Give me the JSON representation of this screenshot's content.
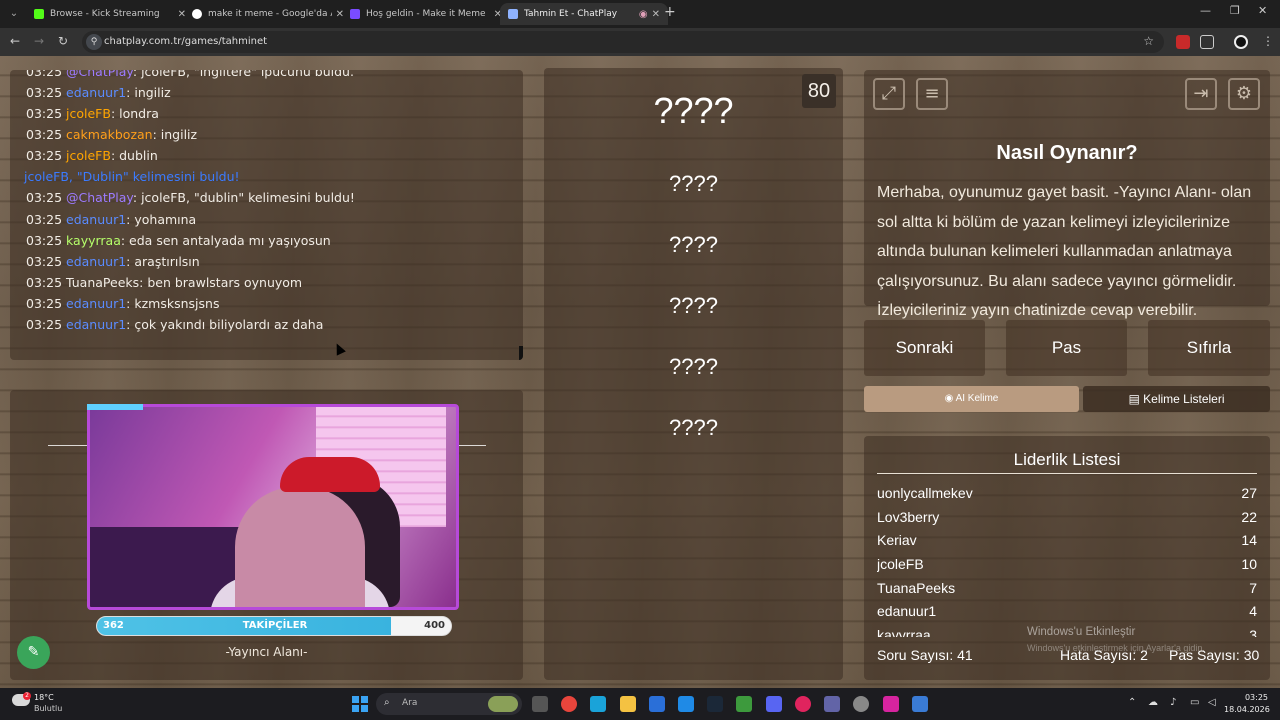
{
  "browser": {
    "tabs": [
      {
        "title": "Browse - Kick Streaming",
        "fav_color": "#53fc18"
      },
      {
        "title": "make it meme - Google'da Ara",
        "fav_color": "#ffffff"
      },
      {
        "title": "Hoş geldin - Make it Meme",
        "fav_color": "#7a4cff"
      },
      {
        "title": "Tahmin Et - ChatPlay",
        "fav_color": "#8fb3ff"
      }
    ],
    "url": "chatplay.com.tr/games/tahminet"
  },
  "chat": {
    "lines": [
      {
        "time": "03:25",
        "user": "@ChatPlay",
        "user_color": "#9d7bff",
        "msg": ": jcoleFB, \"ingiltere\" ipucunu buldu."
      },
      {
        "time": "03:25",
        "user": "edanuur1",
        "user_color": "#5b8cff",
        "msg": ": ingiliz"
      },
      {
        "time": "03:25",
        "user": "jcoleFB",
        "user_color": "#ffa500",
        "msg": ": londra"
      },
      {
        "time": "03:25",
        "user": "cakmakbozan",
        "user_color": "#ff9f1a",
        "msg": ": ingiliz"
      },
      {
        "time": "03:25",
        "user": "jcoleFB",
        "user_color": "#ffa500",
        "msg": ": dublin"
      },
      {
        "time": "",
        "user": "jcoleFB, \"Dublin\" kelimesini buldu!",
        "user_color": "#3b7bff",
        "msg": ""
      },
      {
        "time": "03:25",
        "user": "@ChatPlay",
        "user_color": "#9d7bff",
        "msg": ": jcoleFB, \"dublin\" kelimesini buldu!"
      },
      {
        "time": "03:25",
        "user": "edanuur1",
        "user_color": "#5b8cff",
        "msg": ": yohamına"
      },
      {
        "time": "03:25",
        "user": "kayyrraa",
        "user_color": "#b6ff6b",
        "msg": ": eda sen antalyada mı yaşıyosun"
      },
      {
        "time": "03:25",
        "user": "edanuur1",
        "user_color": "#5b8cff",
        "msg": ": araştırılsın"
      },
      {
        "time": "03:25",
        "user": "TuanaPeeks",
        "user_color": "#f2ede6",
        "msg": ": ben brawlstars oynuyom"
      },
      {
        "time": "03:25",
        "user": "edanuur1",
        "user_color": "#5b8cff",
        "msg": ": kzmsksnsjsns"
      },
      {
        "time": "03:25",
        "user": "edanuur1",
        "user_color": "#5b8cff",
        "msg": ": çok yakındı biliyolardı az daha"
      }
    ]
  },
  "streamer": {
    "followers_min": "362",
    "followers_max": "400",
    "followers_label": "TAKİPÇİLER",
    "followers_progress": 0.83,
    "area_label": "-Yayıncı Alanı-"
  },
  "game": {
    "timer": "80",
    "main_word": "????",
    "words": [
      "????",
      "????",
      "????",
      "????",
      "????"
    ]
  },
  "help": {
    "title": "Nasıl Oynanır?",
    "text": "Merhaba, oyunumuz gayet basit. -Yayıncı Alanı- olan sol altta ki bölüm de yazan kelimeyi izleyicilerinize altında bulunan kelimeleri kullanmadan anlatmaya çalışıyorsunuz. Bu alanı sadece yayıncı görmelidir. İzleyicileriniz yayın chatinizde cevap verebilir."
  },
  "controls": {
    "next": "Sonraki",
    "pass": "Pas",
    "reset": "Sıfırla",
    "ai_word": "AI Kelime",
    "word_lists": "Kelime Listeleri"
  },
  "leaderboard": {
    "title": "Liderlik Listesi",
    "rows": [
      {
        "name": "uonlycallmekev",
        "score": "27"
      },
      {
        "name": "Lov3berry",
        "score": "22"
      },
      {
        "name": "Keriav",
        "score": "14"
      },
      {
        "name": "jcoleFB",
        "score": "10"
      },
      {
        "name": "TuanaPeeks",
        "score": "7"
      },
      {
        "name": "edanuur1",
        "score": "4"
      },
      {
        "name": "kayyrraa",
        "score": "3"
      }
    ]
  },
  "stats": {
    "questions": "Soru Sayısı: 41",
    "errors": "Hata Sayısı: 2",
    "passes": "Pas Sayısı: 30"
  },
  "watermark": {
    "line1": "Windows'u Etkinleştir",
    "line2": "Windows'u etkinleştirmek için Ayarlar'a gidin."
  },
  "taskbar": {
    "temp": "18°C",
    "weather": "Bulutlu",
    "weather_badge": "2",
    "search_placeholder": "Ara",
    "time": "03:25",
    "date": "18.04.2026"
  }
}
